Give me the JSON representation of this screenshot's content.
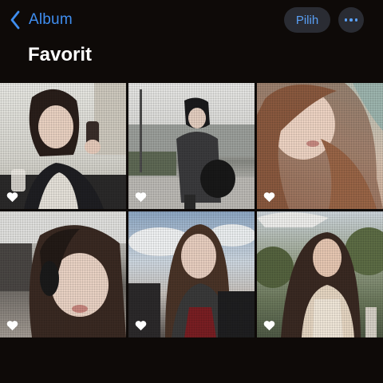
{
  "nav": {
    "back_label": "Album",
    "select_label": "Pilih"
  },
  "page": {
    "title": "Favorit"
  },
  "photos": [
    {
      "favorite": true
    },
    {
      "favorite": true
    },
    {
      "favorite": true
    },
    {
      "favorite": true
    },
    {
      "favorite": true
    },
    {
      "favorite": true
    }
  ],
  "colors": {
    "background": "#0e0a08",
    "accent": "#3f8ef0",
    "pill_background": "#2a2c33",
    "heart": "#ffffff"
  },
  "icons": {
    "back": "chevron-left-icon",
    "more": "ellipsis-icon",
    "favorite": "heart-icon"
  }
}
